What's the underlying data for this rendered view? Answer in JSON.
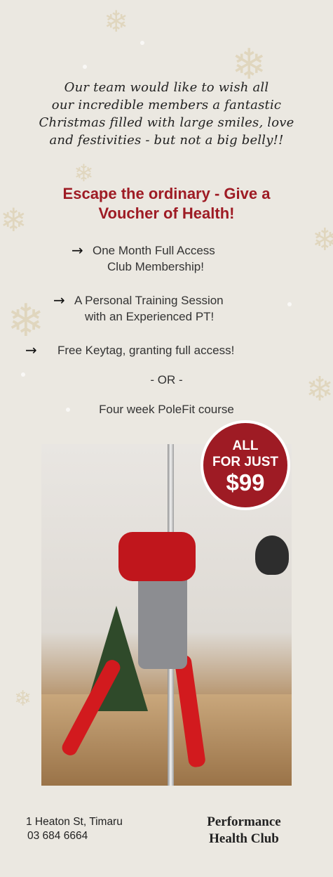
{
  "greeting": {
    "lines": [
      "Our team would like to wish all",
      "our incredible members a fantastic",
      "Christmas filled with large smiles, love",
      "and festivities - but not a big belly!!"
    ]
  },
  "headline": {
    "line1": "Escape the ordinary - Give a",
    "line2": "Voucher of Health!"
  },
  "offers": [
    {
      "line1": "One Month Full Access",
      "line2": "Club Membership!"
    },
    {
      "line1": "A Personal Training Session",
      "line2": "with an Experienced PT!"
    },
    {
      "line1": "Free Keytag, granting full access!"
    }
  ],
  "arrow_icon": "→",
  "or_text": "- OR -",
  "alternative": "Four week PoleFit course",
  "badge": {
    "line1": "ALL",
    "line2": "FOR JUST",
    "price": "$99"
  },
  "contact": {
    "address": "1 Heaton St, Timaru",
    "phone": "03 684 6664"
  },
  "brand": {
    "line1": "Performance",
    "line2": "Health Club"
  },
  "colors": {
    "background": "#ebe8e1",
    "accent": "#9e1b24"
  }
}
